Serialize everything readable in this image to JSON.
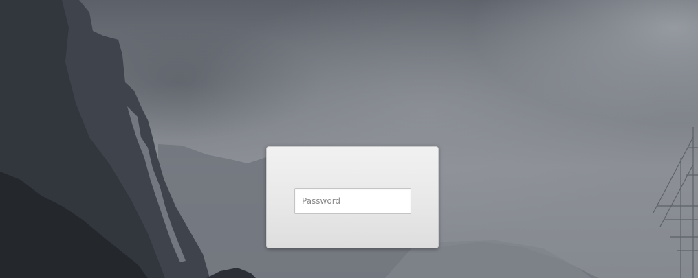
{
  "login": {
    "password_placeholder": "Password",
    "password_value": ""
  },
  "background": {
    "description_icon": "mountain-landscape-background",
    "ship_icon": "sailing-ship-icon"
  },
  "colors": {
    "panel_top": "#f1f1f1",
    "panel_bottom": "#dedede",
    "field_border": "#c4c4c4",
    "placeholder_text": "#8a8a8a"
  }
}
